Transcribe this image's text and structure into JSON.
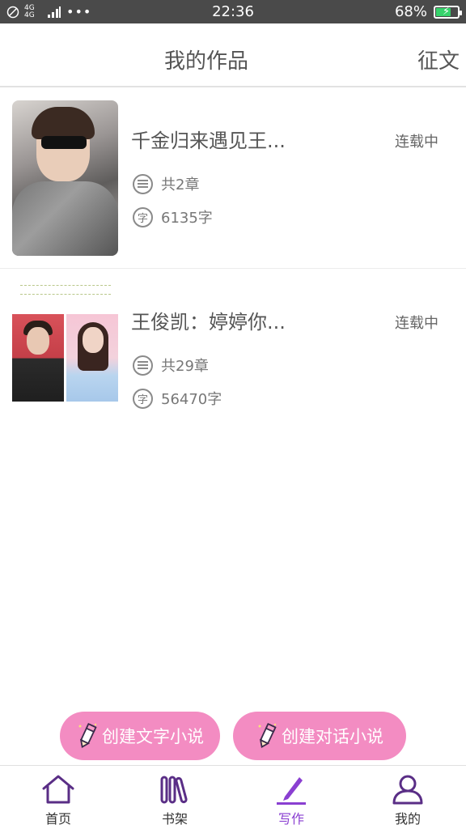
{
  "status_bar": {
    "network": "4G 4G",
    "time": "22:36",
    "battery": "68%",
    "battery_level": 0.68
  },
  "header": {
    "title": "我的作品",
    "action": "征文"
  },
  "works": [
    {
      "title": "千金归来遇见王...",
      "status": "连载中",
      "chapters": "共2章",
      "words": "6135字"
    },
    {
      "title": "王俊凯：婷婷你...",
      "status": "连载中",
      "chapters": "共29章",
      "words": "56470字"
    }
  ],
  "meta_icons": {
    "chapters": "list-icon",
    "words": "zi-character-icon",
    "words_glyph": "字"
  },
  "create_buttons": {
    "text_novel": "创建文字小说",
    "dialog_novel": "创建对话小说"
  },
  "tabbar": {
    "items": [
      {
        "label": "首页",
        "icon": "home-icon"
      },
      {
        "label": "书架",
        "icon": "bookshelf-icon"
      },
      {
        "label": "写作",
        "icon": "write-icon"
      },
      {
        "label": "我的",
        "icon": "profile-icon"
      }
    ],
    "active": "写作"
  },
  "colors": {
    "accent": "#8a3fd1",
    "button_pink": "#f38cc2",
    "status_bar": "#4a4a4a"
  }
}
